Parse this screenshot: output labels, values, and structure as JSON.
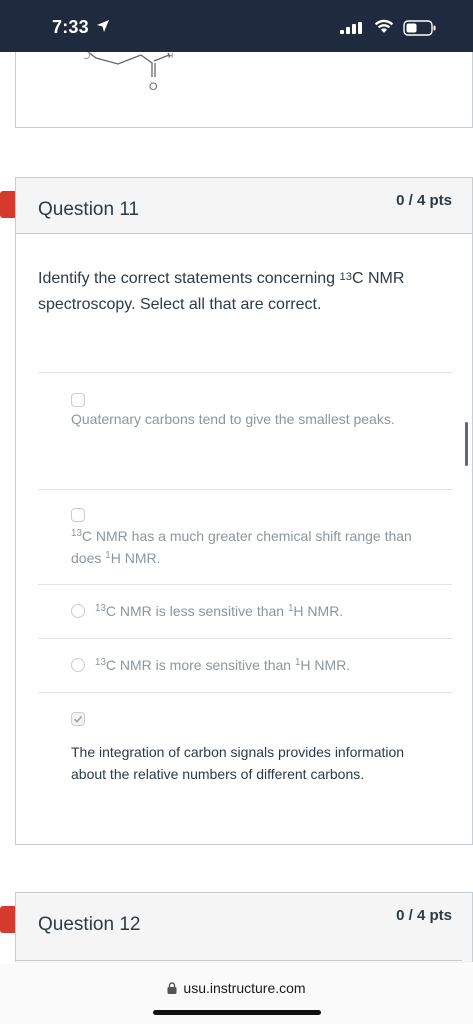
{
  "status_bar": {
    "time": "7:33"
  },
  "questions": [
    {
      "title": "Question 11",
      "points": "0 / 4 pts",
      "text_before": "Identify the correct statements concerning ",
      "text_sup": "13",
      "text_after": "C NMR spectroscopy. Select all that are correct.",
      "answers": [
        {
          "parts": [
            "Quaternary carbons tend to give the smallest peaks."
          ],
          "sups": [],
          "checked": false
        },
        {
          "parts": [
            "C NMR has a much greater chemical shift range than does ",
            "H NMR."
          ],
          "sups": [
            "13",
            "1"
          ],
          "checked": false
        },
        {
          "parts": [
            "C NMR is less sensitive than ",
            "H NMR."
          ],
          "sups": [
            "13",
            "1"
          ],
          "checked": false
        },
        {
          "parts": [
            "C NMR is more sensitive than ",
            "H NMR."
          ],
          "sups": [
            "13",
            "1"
          ],
          "checked": false
        },
        {
          "parts": [
            "The integration of carbon signals provides information about the relative numbers of different carbons."
          ],
          "sups": [],
          "checked": true
        }
      ]
    },
    {
      "title": "Question 12",
      "points": "0 / 4 pts"
    }
  ],
  "browser": {
    "url": "usu.instructure.com"
  },
  "colors": {
    "flag": "#d63a2f",
    "status_bar": "#1f2a3f",
    "text": "#2d3b45",
    "muted_text": "#8b969e"
  }
}
